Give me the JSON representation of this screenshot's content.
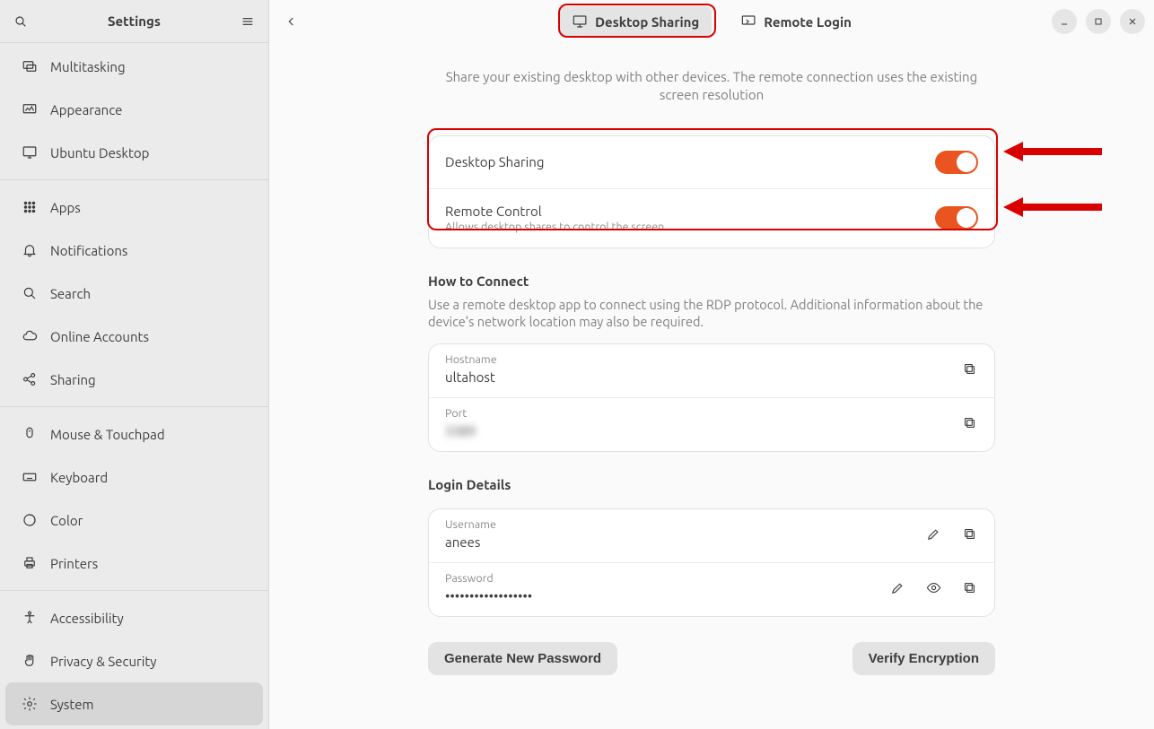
{
  "sidebar": {
    "title": "Settings",
    "items": [
      {
        "label": "Multitasking"
      },
      {
        "label": "Appearance"
      },
      {
        "label": "Ubuntu Desktop"
      },
      {
        "sep": true
      },
      {
        "label": "Apps"
      },
      {
        "label": "Notifications"
      },
      {
        "label": "Search"
      },
      {
        "label": "Online Accounts"
      },
      {
        "label": "Sharing"
      },
      {
        "sep": true
      },
      {
        "label": "Mouse & Touchpad"
      },
      {
        "label": "Keyboard"
      },
      {
        "label": "Color"
      },
      {
        "label": "Printers"
      },
      {
        "sep": true
      },
      {
        "label": "Accessibility"
      },
      {
        "label": "Privacy & Security"
      },
      {
        "label": "System",
        "active": true
      }
    ]
  },
  "header": {
    "tabs": {
      "desktop_sharing": "Desktop Sharing",
      "remote_login": "Remote Login"
    }
  },
  "page": {
    "description": "Share your existing desktop with other devices. The remote connection uses the existing screen resolution",
    "toggles": {
      "desktop_sharing": {
        "label": "Desktop Sharing",
        "on": true
      },
      "remote_control": {
        "label": "Remote Control",
        "sub": "Allows desktop shares to control the screen",
        "on": true
      }
    },
    "connect": {
      "title": "How to Connect",
      "desc": "Use a remote desktop app to connect using the RDP protocol. Additional information about the device's network location may also be required.",
      "hostname": {
        "label": "Hostname",
        "value": "ultahost"
      },
      "port": {
        "label": "Port",
        "value": "3389"
      }
    },
    "login": {
      "title": "Login Details",
      "username": {
        "label": "Username",
        "value": "anees"
      },
      "password": {
        "label": "Password",
        "value": "••••••••••••••••••"
      }
    },
    "buttons": {
      "generate": "Generate New Password",
      "verify": "Verify Encryption"
    }
  }
}
